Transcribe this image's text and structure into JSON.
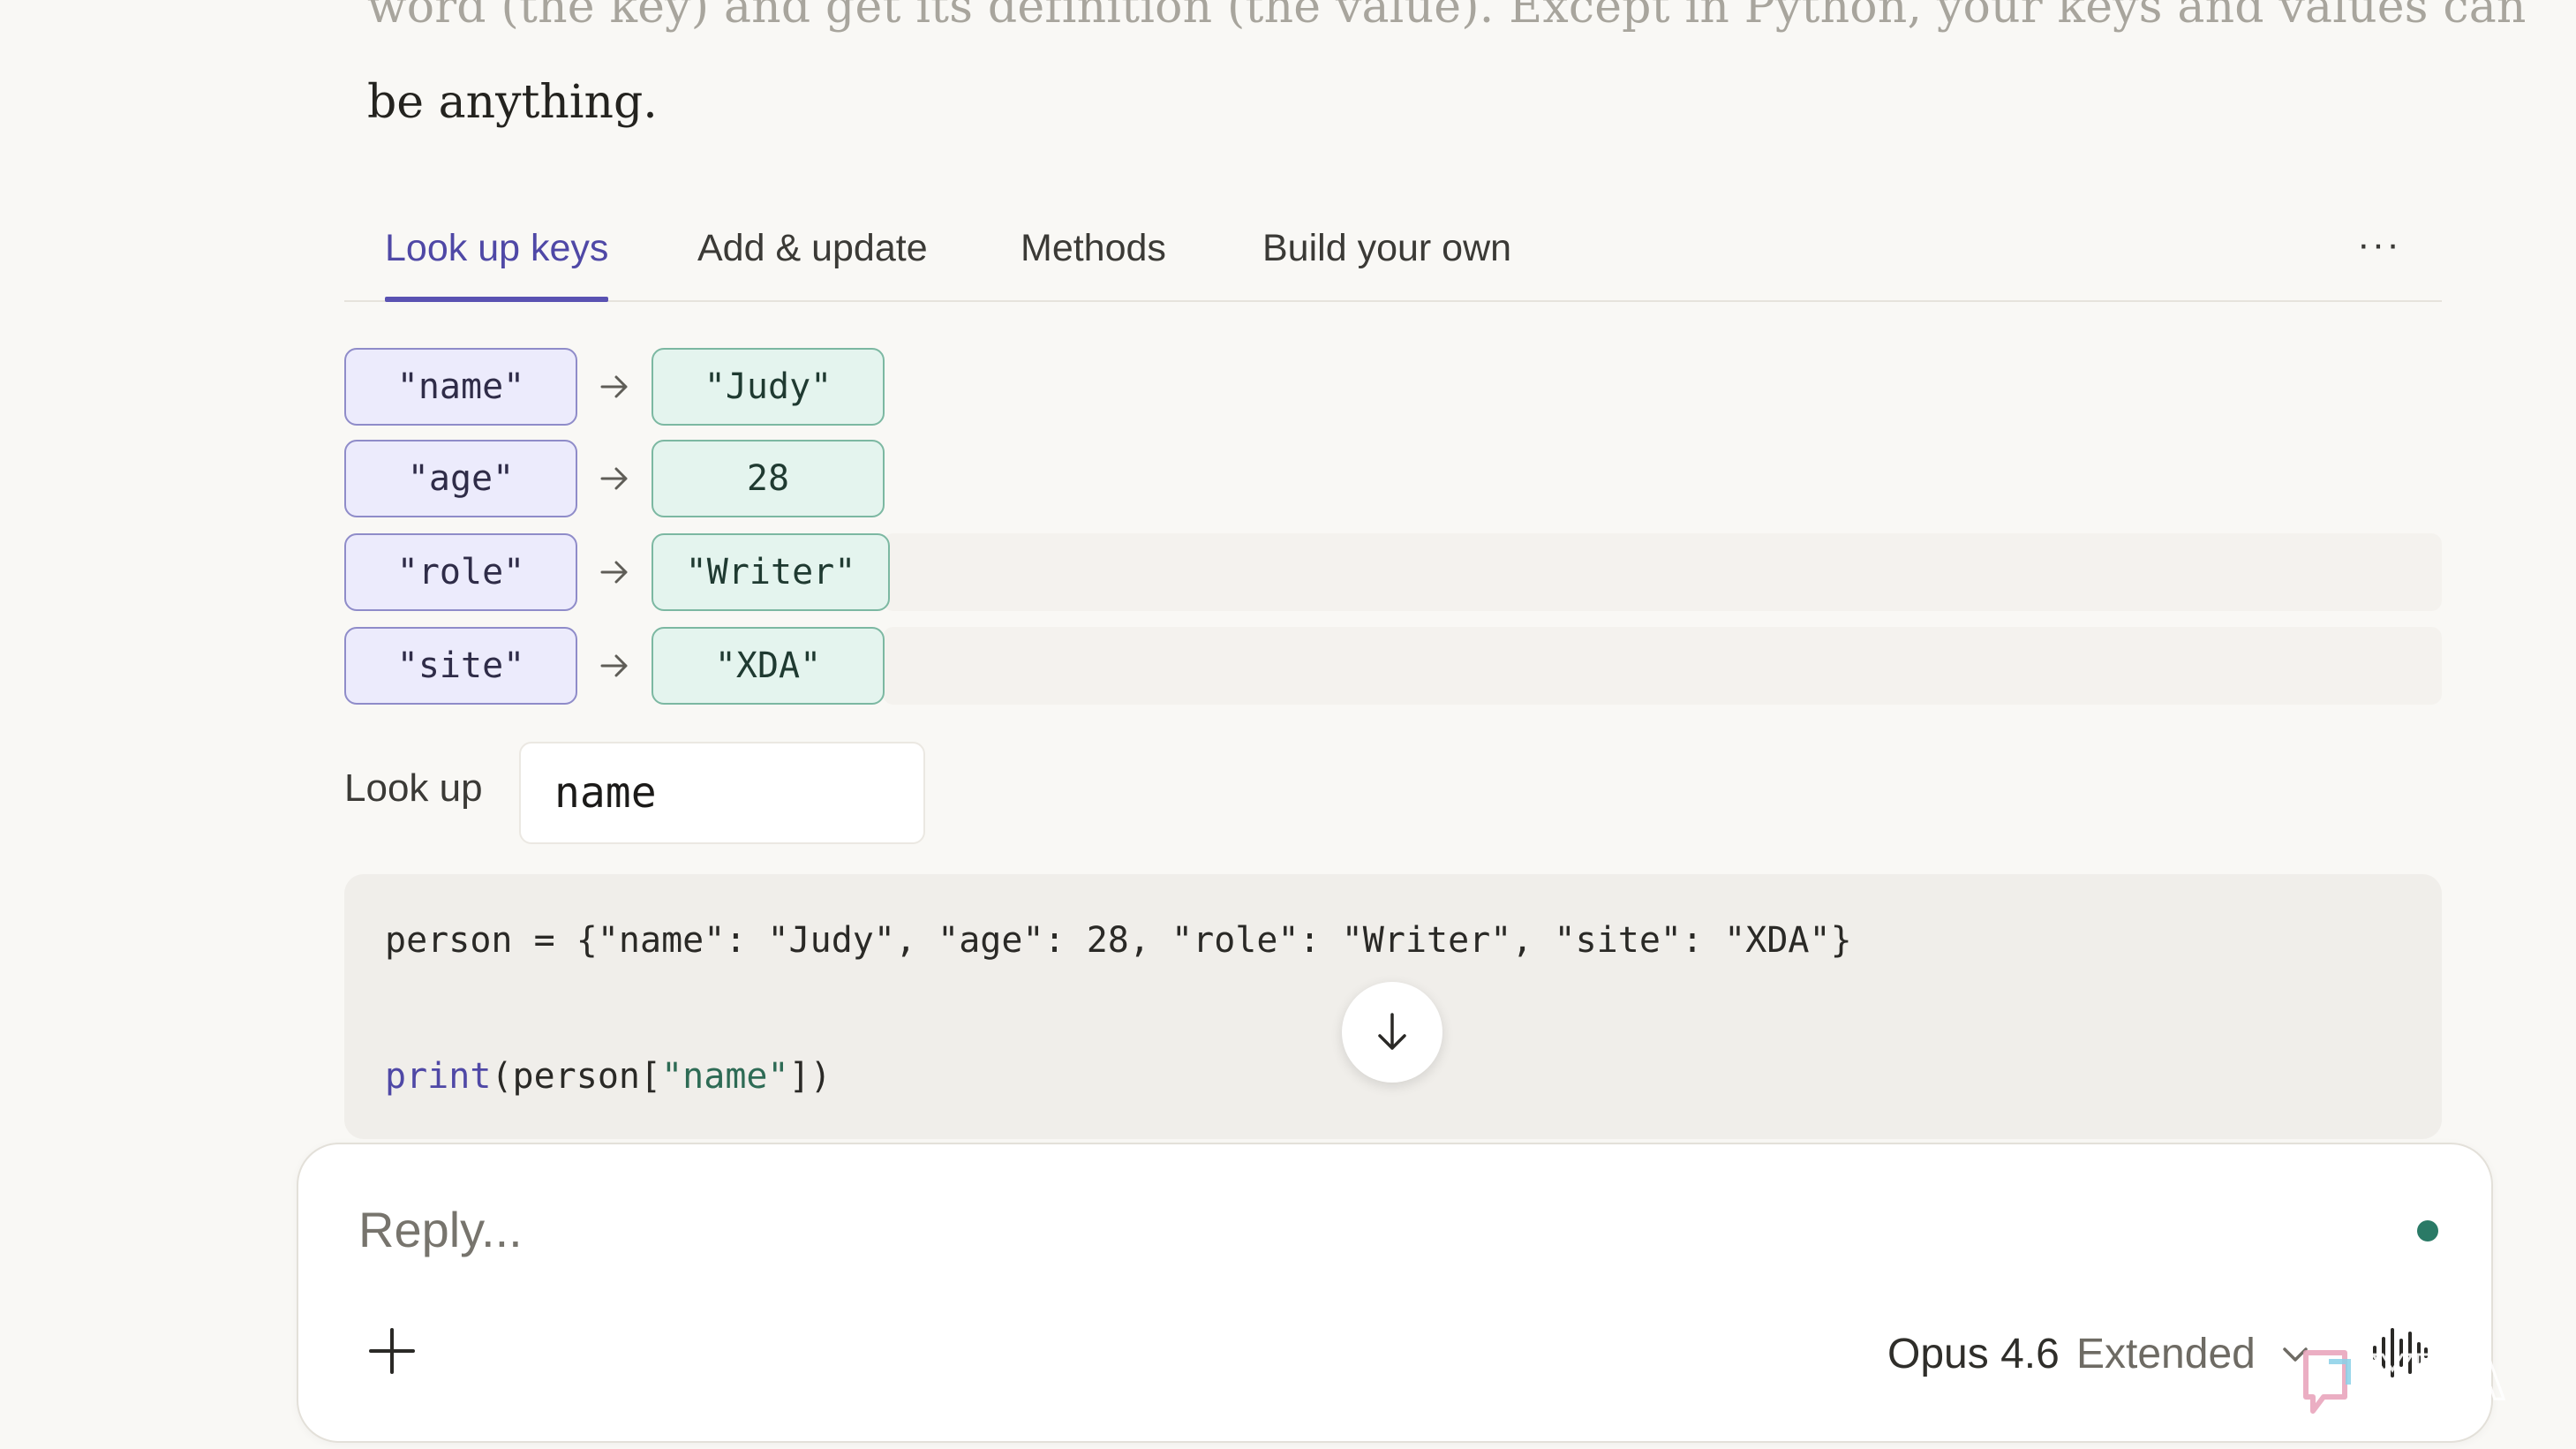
{
  "prose": {
    "line1": "word (the key) and get its definition (the value). Except in Python, your keys and values can",
    "line2": "be anything."
  },
  "tabs": [
    {
      "label": "Look up keys",
      "active": true
    },
    {
      "label": "Add & update",
      "active": false
    },
    {
      "label": "Methods",
      "active": false
    },
    {
      "label": "Build your own",
      "active": false
    }
  ],
  "more_label": "···",
  "dict": [
    {
      "key": "\"name\"",
      "value": "\"Judy\""
    },
    {
      "key": "\"age\"",
      "value": "28"
    },
    {
      "key": "\"role\"",
      "value": "\"Writer\""
    },
    {
      "key": "\"site\"",
      "value": "\"XDA\""
    }
  ],
  "lookup": {
    "label": "Look up",
    "value": "name"
  },
  "code": {
    "line1": "person = {\"name\": \"Judy\", \"age\": 28, \"role\": \"Writer\", \"site\": \"XDA\"}",
    "line2_fn": "print",
    "line2_open": "(person[",
    "line2_str": "\"name\"",
    "line2_close": "])"
  },
  "composer": {
    "placeholder": "Reply...",
    "model_name": "Opus 4.6",
    "model_mode": "Extended"
  },
  "icons": {
    "arrow": "arrow-right-icon",
    "scroll": "arrow-down-icon",
    "plus": "plus-icon",
    "chevron": "chevron-down-icon",
    "voice": "voice-waveform-icon",
    "watermark": "xda-logo"
  },
  "watermark_text": "XDA",
  "colors": {
    "accent": "#5a52b2",
    "key_bg": "#ecebfc",
    "value_bg": "#e4f4ee",
    "status_dot": "#2a7a66"
  }
}
